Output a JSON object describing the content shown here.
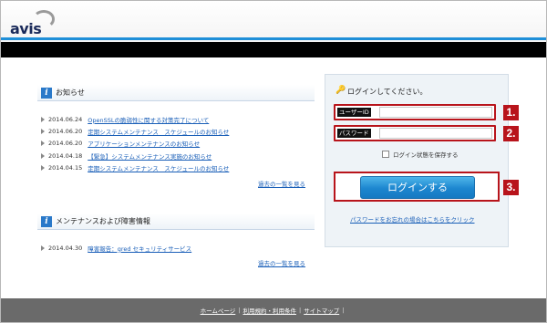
{
  "header": {
    "logo_text": "avis"
  },
  "notices": {
    "title": "お知らせ",
    "items": [
      {
        "date": "2014.06.24",
        "text": "OpenSSLの脆弱性に関する対策完了について"
      },
      {
        "date": "2014.06.20",
        "text": "定期システムメンテナンス　スケジュールのお知らせ"
      },
      {
        "date": "2014.06.20",
        "text": "アプリケーションメンテナンスのお知らせ"
      },
      {
        "date": "2014.04.18",
        "text": "【緊急】システムメンテナンス実施のお知らせ"
      },
      {
        "date": "2014.04.15",
        "text": "定期システムメンテナンス　スケジュールのお知らせ"
      }
    ],
    "more": "過去の一覧を見る"
  },
  "maintenance": {
    "title": "メンテナンスおよび障害情報",
    "items": [
      {
        "date": "2014.04.30",
        "text": "障害報告：gred セキュリティサービス"
      }
    ],
    "more": "過去の一覧を見る"
  },
  "login": {
    "title": "ログインしてください。",
    "user_label": "ユーザーID",
    "user_value": "",
    "password_label": "パスワード",
    "password_value": "",
    "remember_label": "ログイン状態を保存する",
    "remember_checked": false,
    "button_label": "ログインする",
    "forgot_link": "パスワードをお忘れの場合はこちらをクリック",
    "steps": [
      "1.",
      "2.",
      "3."
    ]
  },
  "footer": {
    "links": [
      "ホームページ",
      "利用規約・利用条件",
      "サイトマップ"
    ],
    "separator": "|"
  },
  "colors": {
    "accent_blue": "#1f8fd8",
    "highlight_red": "#b8141b",
    "link_blue": "#1a5fb8",
    "footer_gray": "#6a6a6a"
  }
}
